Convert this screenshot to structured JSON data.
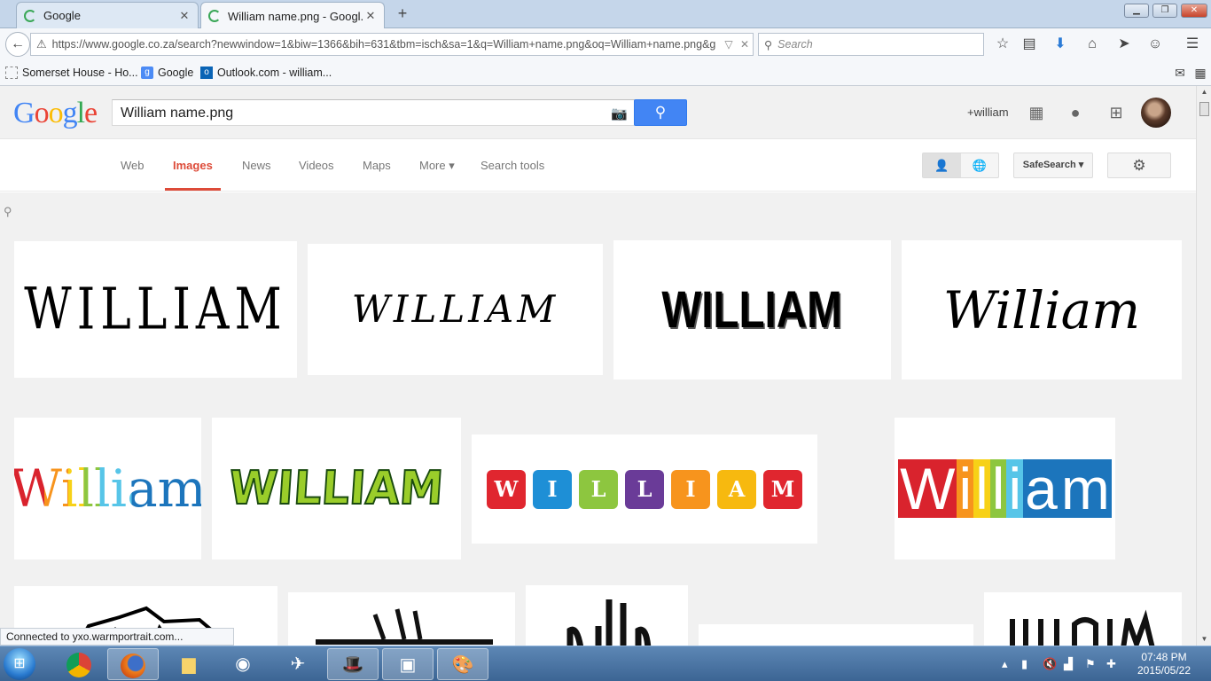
{
  "browser": {
    "tabs": [
      {
        "title": "Google",
        "close": "✕"
      },
      {
        "title": "William name.png - Googl...",
        "close": "✕"
      }
    ],
    "new_tab": "+",
    "window_controls": {
      "minimize": "▁",
      "restore": "❐",
      "close": "✕"
    },
    "url": "https://www.google.co.za/search?newwindow=1&biw=1366&bih=631&tbm=isch&sa=1&q=William+name.png&oq=William+name.png&g",
    "search_placeholder": "Search",
    "bookmarks": [
      {
        "label": "Somerset House - Ho...",
        "icon": "page-icon"
      },
      {
        "label": "Google",
        "icon": "google-icon"
      },
      {
        "label": "Outlook.com - william...",
        "icon": "outlook-icon"
      }
    ]
  },
  "google": {
    "logo": [
      "G",
      "o",
      "o",
      "g",
      "l",
      "e"
    ],
    "logo_colors": [
      "#4285f4",
      "#ea4335",
      "#fbbc05",
      "#4285f4",
      "#34a853",
      "#ea4335"
    ],
    "query": "William name.png",
    "user": "+william",
    "menu": {
      "web": "Web",
      "images": "Images",
      "news": "News",
      "videos": "Videos",
      "maps": "Maps",
      "more": "More ▾",
      "search_tools": "Search tools"
    },
    "safesearch": "SafeSearch ▾",
    "results": [
      {
        "text": "WILLIAM",
        "style": "ornate-black"
      },
      {
        "text": "WILLIAM",
        "style": "calligraphy"
      },
      {
        "text": "WILLIAM",
        "style": "grunge-bold"
      },
      {
        "text": "William",
        "style": "arabic-style"
      },
      {
        "text": "William",
        "style": "rainbow-serif"
      },
      {
        "text": "WILLIAM",
        "style": "cartoon-green"
      },
      {
        "letters": [
          "W",
          "I",
          "L",
          "L",
          "I",
          "A",
          "M"
        ],
        "colors": [
          "#e0262f",
          "#1e8fd6",
          "#8dc63f",
          "#6a3b98",
          "#f7941d",
          "#f7b90f",
          "#e0262f"
        ]
      },
      {
        "letters": [
          "W",
          "i",
          "l",
          "l",
          "i",
          "a",
          "m"
        ],
        "colors": [
          "#d9232d",
          "#f7941d",
          "#f7d117",
          "#8dc63f",
          "#57c5e8",
          "#1c75bc",
          "#1c75bc"
        ]
      }
    ]
  },
  "status": "Connected to yxo.warmportrait.com...",
  "clock": {
    "time": "07:48 PM",
    "date": "2015/05/22"
  }
}
